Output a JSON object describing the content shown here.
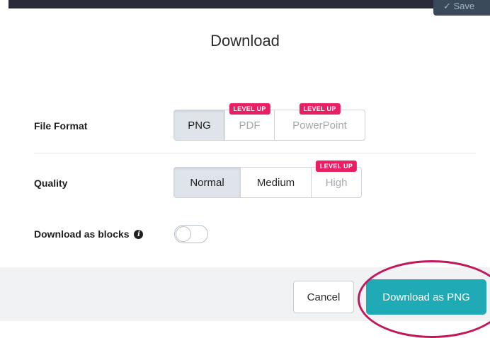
{
  "topbar": {
    "save_label": "✓ Save"
  },
  "dialog": {
    "title": "Download",
    "file_format": {
      "label": "File Format",
      "options": [
        {
          "label": "PNG",
          "badge": ""
        },
        {
          "label": "PDF",
          "badge": "LEVEL UP"
        },
        {
          "label": "PowerPoint",
          "badge": "LEVEL UP"
        }
      ],
      "selected": "PNG"
    },
    "quality": {
      "label": "Quality",
      "options": [
        {
          "label": "Normal",
          "badge": ""
        },
        {
          "label": "Medium",
          "badge": ""
        },
        {
          "label": "High",
          "badge": "LEVEL UP"
        }
      ],
      "selected": "Normal"
    },
    "blocks": {
      "label": "Download as blocks",
      "info_icon": "info-icon",
      "toggle_on": false
    },
    "footer": {
      "cancel_label": "Cancel",
      "download_label": "Download as PNG"
    }
  },
  "colors": {
    "accent": "#1faab6",
    "badge": "#e91e63",
    "highlight": "#c2185b"
  }
}
